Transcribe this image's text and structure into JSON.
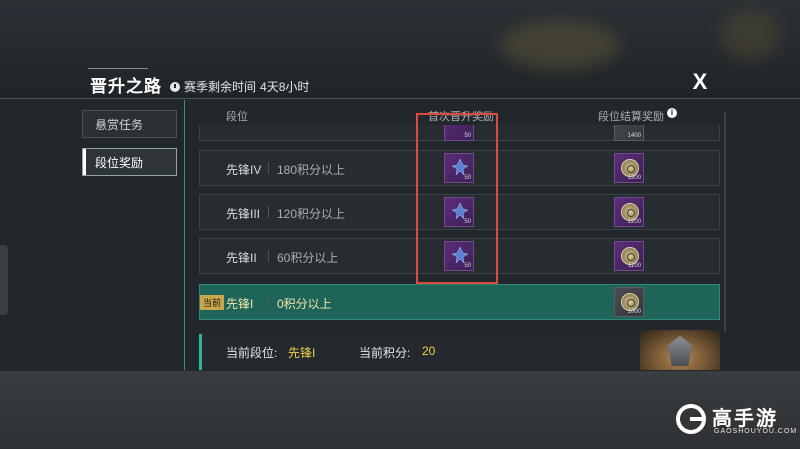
{
  "window": {
    "title": "晋升之路",
    "season_label": "赛季剩余时间",
    "season_remaining": "4天8小时",
    "close_label": "X"
  },
  "nav": {
    "items": [
      {
        "label": "悬赏任务"
      },
      {
        "label": "段位奖励"
      }
    ]
  },
  "table": {
    "headers": {
      "rank": "段位",
      "first_promotion": "首次晋升奖励",
      "settlement": "段位结算奖励",
      "info_icon": "i"
    },
    "rows": [
      {
        "rank": "",
        "requirement": "",
        "first_reward_qty": "50",
        "settle_reward_qty": "1400",
        "partial": true
      },
      {
        "rank": "先锋IV",
        "requirement": "180积分以上",
        "first_reward_qty": "50",
        "settle_reward_qty": "1300"
      },
      {
        "rank": "先锋III",
        "requirement": "120积分以上",
        "first_reward_qty": "50",
        "settle_reward_qty": "1200"
      },
      {
        "rank": "先锋II",
        "requirement": "60积分以上",
        "first_reward_qty": "50",
        "settle_reward_qty": "1100"
      },
      {
        "rank": "先锋I",
        "requirement": "0积分以上",
        "settle_reward_qty": "1000",
        "current": true,
        "badge": "当前"
      }
    ]
  },
  "status": {
    "rank_label": "当前段位:",
    "rank_value": "先锋I",
    "points_label": "当前积分:",
    "points_value": "20"
  },
  "watermark": {
    "brand": "高手游",
    "domain": "GAOSHOUYOU.COM"
  },
  "colors": {
    "accent_teal": "#2fb39a",
    "current_row": "#1e6459",
    "highlight_box": "#e04a3c",
    "gold_text": "#f0d04a"
  }
}
